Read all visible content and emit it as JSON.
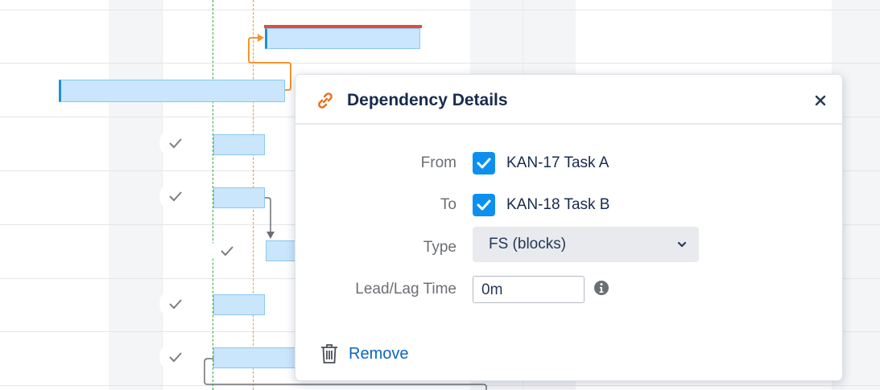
{
  "popup": {
    "title": "Dependency Details",
    "close_icon": "close-icon",
    "link_icon": "link-icon",
    "from_label": "From",
    "from_value": "KAN-17 Task A",
    "from_checked": true,
    "to_label": "To",
    "to_value": "KAN-18 Task B",
    "to_checked": true,
    "type_label": "Type",
    "type_value": "FS (blocks)",
    "lead_lag_label": "Lead/Lag Time",
    "lead_lag_value": "0m",
    "info_icon": "info-icon",
    "remove_label": "Remove",
    "remove_icon": "trash-icon"
  },
  "gantt": {
    "check_icon": "checkmark-icon",
    "colors": {
      "bar_fill": "#c9e6fc",
      "bar_border": "#8cc7f2",
      "bar_start_mark": "#1f8ed8",
      "critical_line": "#de4d3e",
      "today_line": "#3aa846",
      "marker_line": "#f0962d",
      "dependency_orange": "#f0962d",
      "dependency_gray": "#6b6f75"
    }
  }
}
